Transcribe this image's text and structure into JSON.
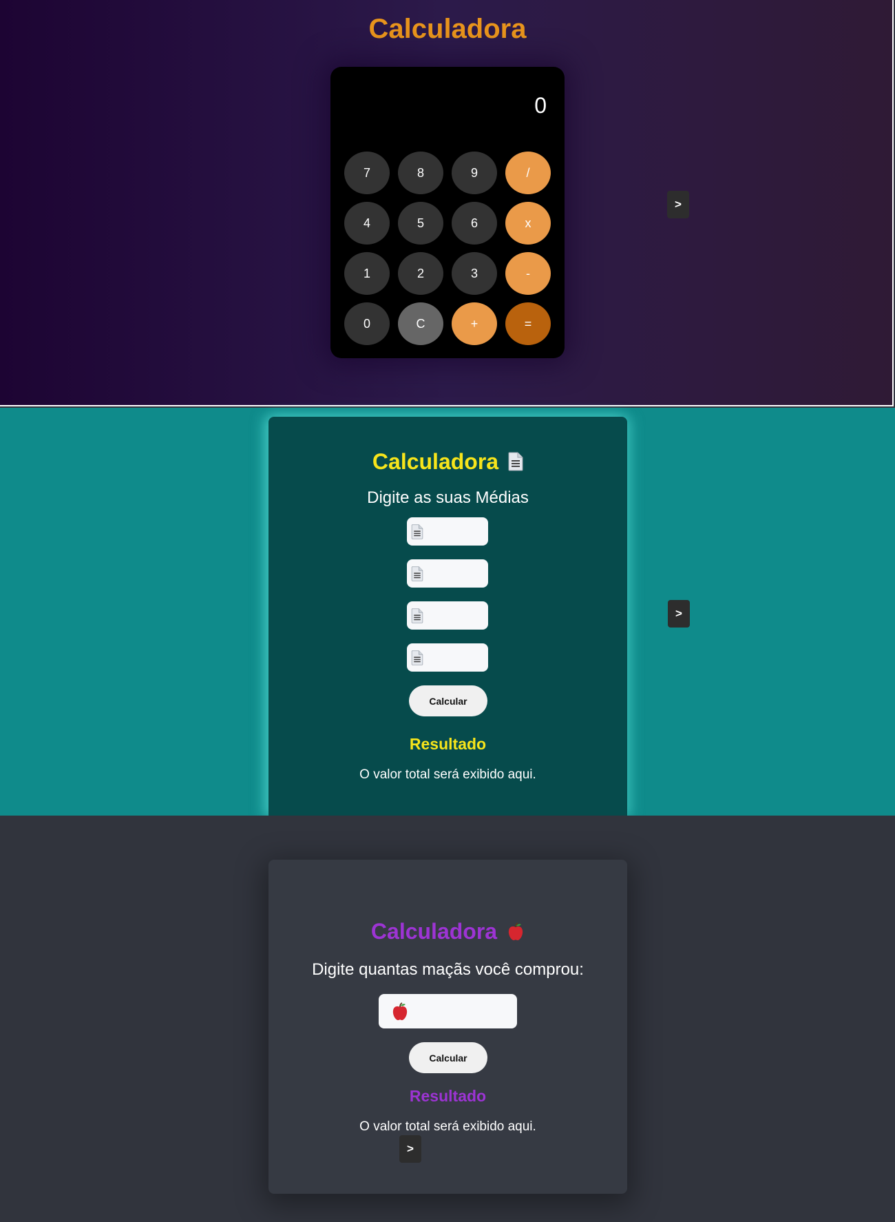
{
  "basic_calculator": {
    "title": "Calculadora",
    "display": "0",
    "keys": [
      "7",
      "8",
      "9",
      "/",
      "4",
      "5",
      "6",
      "x",
      "1",
      "2",
      "3",
      "-",
      "0",
      "C",
      "+",
      "="
    ],
    "next_label": ">"
  },
  "grades_calculator": {
    "title": "Calculadora",
    "title_icon": "document-icon",
    "subtitle": "Digite as suas Médias",
    "inputs": [
      {
        "icon": "document-icon",
        "value": ""
      },
      {
        "icon": "document-icon",
        "value": ""
      },
      {
        "icon": "document-icon",
        "value": ""
      },
      {
        "icon": "document-icon",
        "value": ""
      }
    ],
    "button_label": "Calcular",
    "result_title": "Resultado",
    "result_text": "O valor total será exibido aqui.",
    "next_label": ">"
  },
  "apples_calculator": {
    "title": "Calculadora",
    "title_icon": "apple-icon",
    "subtitle": "Digite quantas maçãs você comprou:",
    "input": {
      "icon": "apple-icon",
      "value": ""
    },
    "button_label": "Calcular",
    "result_title": "Resultado",
    "result_text": "O valor total será exibido aqui.",
    "next_label": ">"
  },
  "colors": {
    "calc_title": "#e8941c",
    "operator": "#ea9a49",
    "equals": "#b9620d",
    "grades_accent": "#f7e51b",
    "apples_accent": "#9d34d4",
    "teal_bg": "#0f8b8b"
  }
}
